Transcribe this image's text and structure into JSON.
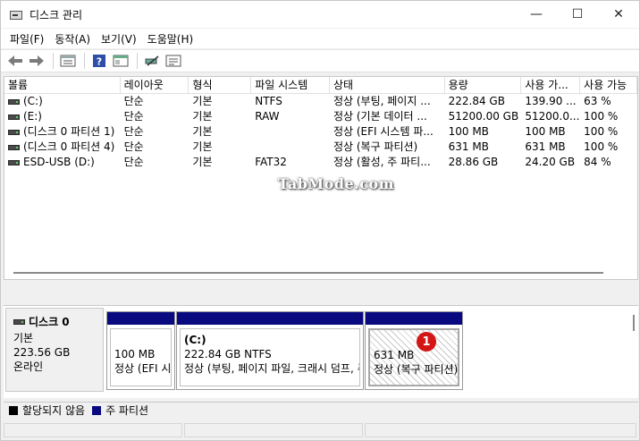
{
  "window": {
    "title": "디스크 관리",
    "minimize": "—",
    "maximize": "☐",
    "close": "✕"
  },
  "menu": [
    "파일(F)",
    "동작(A)",
    "보기(V)",
    "도움말(H)"
  ],
  "toolbar": [
    "back-arrow-icon",
    "forward-arrow-icon",
    "disk-list-icon",
    "help-icon",
    "view-icon",
    "connect-icon",
    "properties-icon"
  ],
  "table": {
    "headers": [
      "볼륨",
      "레이아웃",
      "형식",
      "파일 시스템",
      "상태",
      "용량",
      "사용 가...",
      "사용 가능"
    ],
    "rows": [
      [
        "(C:)",
        "단순",
        "기본",
        "NTFS",
        "정상 (부팅, 페이지 ...",
        "222.84 GB",
        "139.90 ...",
        "63 %"
      ],
      [
        "(E:)",
        "단순",
        "기본",
        "RAW",
        "정상 (기본 데이터 ...",
        "51200.00 GB",
        "51200.0...",
        "100 %"
      ],
      [
        "(디스크 0 파티션 1)",
        "단순",
        "기본",
        "",
        "정상 (EFI 시스템 파...",
        "100 MB",
        "100 MB",
        "100 %"
      ],
      [
        "(디스크 0 파티션 4)",
        "단순",
        "기본",
        "",
        "정상 (복구 파티션)",
        "631 MB",
        "631 MB",
        "100 %"
      ],
      [
        "ESD-USB (D:)",
        "단순",
        "기본",
        "FAT32",
        "정상 (활성, 주 파티...",
        "28.86 GB",
        "24.20 GB",
        "84 %"
      ]
    ]
  },
  "watermark": "TabMode.com",
  "disk": {
    "name": "디스크 0",
    "type": "기본",
    "size": "223.56 GB",
    "state": "온라인",
    "partitions": [
      {
        "title": "",
        "size": "100 MB",
        "status": "정상 (EFI 시스템 파티션)"
      },
      {
        "title": "(C:)",
        "size": "222.84 GB NTFS",
        "status": "정상 (부팅, 페이지 파일, 크래시 덤프, 주 파티션)"
      },
      {
        "title": "",
        "size": "631 MB",
        "status": "정상 (복구 파티션)"
      }
    ],
    "marker": "1"
  },
  "legend": [
    {
      "label": "할당되지 않음",
      "color": "#000000"
    },
    {
      "label": "주 파티션",
      "color": "#0a0a80"
    }
  ],
  "colors": {
    "primary_partition": "#0a0a80",
    "marker": "#d41515"
  }
}
